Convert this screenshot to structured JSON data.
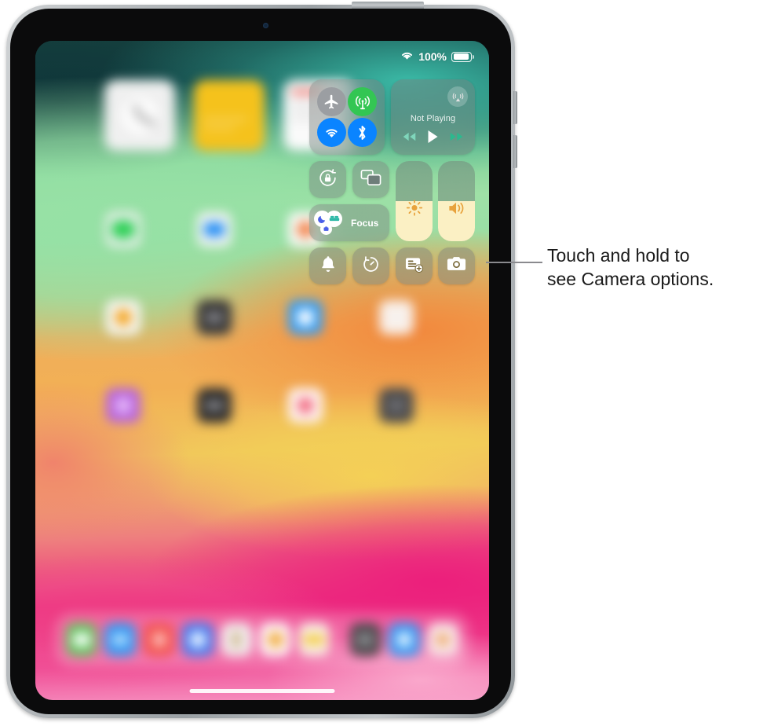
{
  "device": {
    "name": "iPad",
    "front_camera": "front-camera-dot",
    "power_button": "power-button",
    "volume_up_button": "volume-up-button",
    "volume_down_button": "volume-down-button",
    "home_indicator": "home-indicator"
  },
  "status_bar": {
    "wifi_icon": "wifi-icon",
    "battery_percent": "100%",
    "battery_icon": "battery-icon",
    "battery_level": 100
  },
  "control_center": {
    "connectivity": {
      "airplane_mode": {
        "label": "Airplane Mode",
        "icon": "airplane-icon",
        "state": "off",
        "color": "#9b9ea2"
      },
      "cellular_data": {
        "label": "Cellular Data",
        "icon": "cellular-icon",
        "state": "on",
        "color": "#33c653"
      },
      "wifi": {
        "label": "Wi-Fi",
        "icon": "wifi-icon",
        "state": "on",
        "color": "#0a84ff"
      },
      "bluetooth": {
        "label": "Bluetooth",
        "icon": "bluetooth-icon",
        "state": "on",
        "color": "#0a84ff"
      }
    },
    "media": {
      "now_playing_text": "Not Playing",
      "airplay_icon": "airplay-icon",
      "rewind_icon": "rewind-icon",
      "play_icon": "play-icon",
      "fast_forward_icon": "fast-forward-icon"
    },
    "rotation_lock": {
      "label": "Rotation Lock",
      "icon": "rotation-lock-icon"
    },
    "screen_mirroring": {
      "label": "Screen Mirroring",
      "icon": "screen-mirroring-icon"
    },
    "focus": {
      "label": "Focus",
      "icons": [
        "moon-icon",
        "sleep-bed-icon",
        "work-icon"
      ]
    },
    "brightness_slider": {
      "label": "Brightness",
      "icon": "brightness-sun-icon",
      "value": 50
    },
    "volume_slider": {
      "label": "Volume",
      "icon": "volume-speaker-icon",
      "value": 50
    },
    "silent_mode": {
      "label": "Silent Mode",
      "icon": "bell-icon"
    },
    "timer": {
      "label": "Timer",
      "icon": "timer-icon"
    },
    "quick_note": {
      "label": "Quick Note",
      "icon": "new-note-icon"
    },
    "camera": {
      "label": "Camera",
      "icon": "camera-icon"
    }
  },
  "callout": {
    "line1": "Touch and hold to",
    "line2": "see Camera options.",
    "leader_line_color": "#8a8a8e"
  },
  "home_screen": {
    "widgets": [
      {
        "name": "clock-widget",
        "color": "#f2f2f2"
      },
      {
        "name": "notes-widget",
        "color": "#f7c322"
      },
      {
        "name": "news-widget",
        "color": "#fafafa"
      }
    ],
    "app_rows": [
      [
        {
          "name": "messages-app",
          "bg": "#f2f2f2",
          "glyph": "#30d158"
        },
        {
          "name": "facetime-app",
          "bg": "#f5f5f5",
          "glyph": "#1f8cf5"
        },
        {
          "name": "photos-app",
          "bg": "#fbfbfb",
          "glyph": "#f2774a"
        }
      ],
      [
        {
          "name": "notes-app",
          "bg": "#f7f7f7",
          "glyph": "#f5a623"
        },
        {
          "name": "settings-app",
          "bg": "#3a3a3c",
          "glyph": "#8e8e93"
        },
        {
          "name": "appstore-app",
          "bg": "#2f9bf5",
          "glyph": "#ffffff"
        },
        {
          "name": "mail-app",
          "bg": "#f7eeea",
          "glyph": "#f5f5f5"
        }
      ],
      [
        {
          "name": "podcasts-app",
          "bg": "#b562e0",
          "glyph": "#e6b6f7"
        },
        {
          "name": "files-app",
          "bg": "#2e2e30",
          "glyph": "#9b9b9f"
        },
        {
          "name": "health-app",
          "bg": "#fdf4f5",
          "glyph": "#f2637a"
        },
        {
          "name": "camera-app",
          "bg": "#4a4a4d",
          "glyph": "#6e6e72"
        }
      ]
    ],
    "dock_icons": [
      {
        "name": "dock-messages",
        "bg": "#5fc85f",
        "glyph": "#ffffff"
      },
      {
        "name": "dock-facetime",
        "bg": "#2f9bf5",
        "glyph": "#cfe6fb"
      },
      {
        "name": "dock-music",
        "bg": "#f2564f",
        "glyph": "#ffb8b4"
      },
      {
        "name": "dock-safari",
        "bg": "#3a7bf2",
        "glyph": "#dceafd"
      },
      {
        "name": "dock-pages",
        "bg": "#f0f0f0",
        "glyph": "#c7a26a"
      },
      {
        "name": "dock-photos",
        "bg": "#fcfcfc",
        "glyph": "#f2a93b"
      },
      {
        "name": "dock-notes",
        "bg": "#f7f2e8",
        "glyph": "#f5c93a"
      },
      {
        "name": "dock-files",
        "bg": "#4a4a4c",
        "glyph": "#8a8a8e"
      },
      {
        "name": "dock-appstore",
        "bg": "#2f9bf5",
        "glyph": "#e4f1fe"
      },
      {
        "name": "dock-recent",
        "bg": "#f6eaea",
        "glyph": "#f1a561"
      }
    ]
  }
}
